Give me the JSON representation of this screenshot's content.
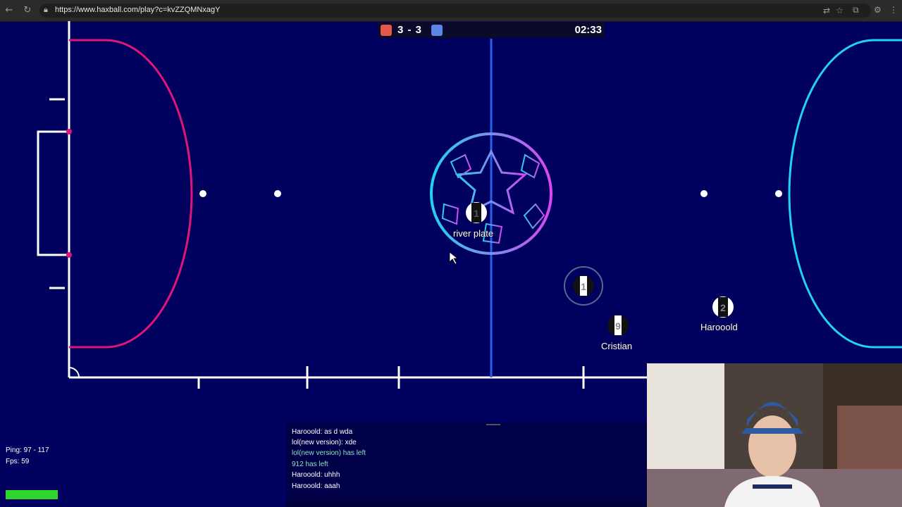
{
  "browser": {
    "url": "https://www.haxball.com/play?c=kvZZQMNxagY",
    "back_icon": "arrow-left-icon",
    "reload_icon": "reload-icon"
  },
  "scoreboard": {
    "score": "3 - 3",
    "time": "02:33",
    "red_color": "#e5564b",
    "blue_color": "#5b86e5"
  },
  "players": [
    {
      "number": "1",
      "name": "river plate"
    },
    {
      "number": "1",
      "name": ""
    },
    {
      "number": "9",
      "name": "Cristian"
    },
    {
      "number": "2",
      "name": "Harooold"
    }
  ],
  "hud": {
    "ping": "Ping: 97 - 117",
    "fps": "Fps: 59"
  },
  "chat": {
    "messages": [
      {
        "text": "Harooold: as d wda",
        "type": "player"
      },
      {
        "text": "lol(new version): xde",
        "type": "player"
      },
      {
        "text": "lol(new version) has left",
        "type": "system"
      },
      {
        "text": "912 has left",
        "type": "system"
      },
      {
        "text": "Harooold: uhhh",
        "type": "player"
      },
      {
        "text": "Harooold: aaah",
        "type": "player"
      }
    ]
  },
  "colors": {
    "field_bg": "#00005e",
    "left_arc": "#e0157a",
    "right_arc": "#22d3ee",
    "center_line": "#2563eb"
  }
}
